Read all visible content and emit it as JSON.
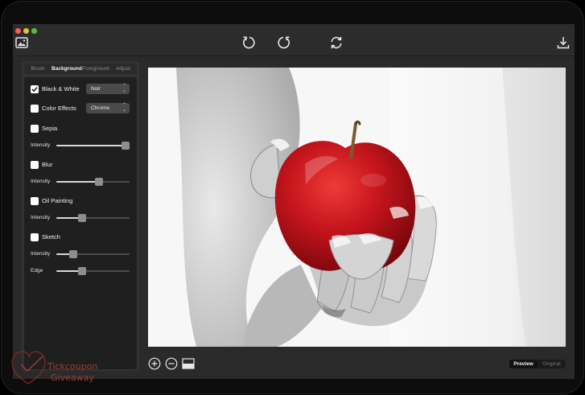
{
  "window": {
    "toolbar_icons": [
      "image-icon",
      "undo-icon",
      "redo-icon",
      "refresh-icon",
      "download-icon"
    ]
  },
  "sidebar": {
    "tabs": [
      {
        "label": "Brush",
        "active": false
      },
      {
        "label": "Background",
        "active": true
      },
      {
        "label": "Foreground",
        "active": false
      },
      {
        "label": "Adjust",
        "active": false
      }
    ],
    "effects": {
      "black_white": {
        "label": "Black & White",
        "checked": true,
        "select": "Noir"
      },
      "color_effects": {
        "label": "Color Effects",
        "checked": false,
        "select": "Chrome"
      },
      "sepia": {
        "label": "Sepia",
        "checked": false,
        "intensity_label": "Intensity",
        "intensity": 0.95
      },
      "blur": {
        "label": "Blur",
        "checked": false,
        "intensity_label": "Intensity",
        "intensity": 0.58
      },
      "oil_painting": {
        "label": "Oil Painting",
        "checked": false,
        "intensity_label": "Intensity",
        "intensity": 0.35
      },
      "sketch": {
        "label": "Sketch",
        "checked": false,
        "intensity_label": "Intensity",
        "intensity": 0.23,
        "edge_label": "Edge",
        "edge": 0.35
      }
    }
  },
  "bottom_bar": {
    "zoom_in_icon": "zoom-in-icon",
    "zoom_out_icon": "zoom-out-icon",
    "compare_icon": "split-view-icon",
    "view_toggle": {
      "preview": "Preview",
      "original": "Original",
      "selected": "Preview"
    }
  },
  "watermark": {
    "line1": "Tickcoupon",
    "line2": "Giveaway"
  },
  "colors": {
    "window_bg": "#2a2a2a",
    "panel_bg": "#1f1f1f",
    "apple_red": "#c4141c"
  }
}
